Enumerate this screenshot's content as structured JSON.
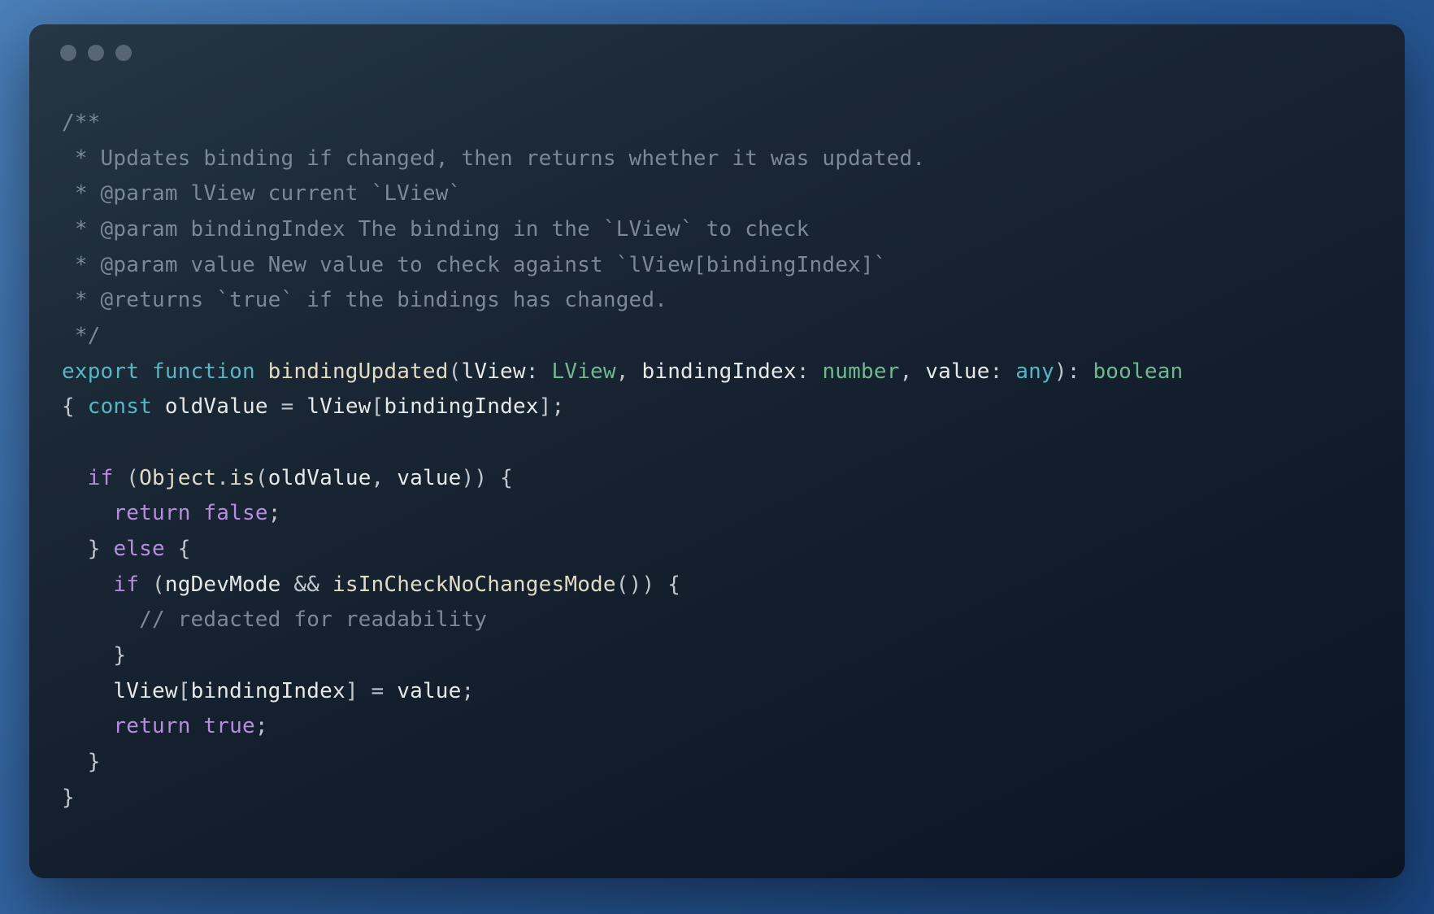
{
  "colors": {
    "bg_gradient_start": "#4a7fb8",
    "bg_gradient_end": "#1a4580",
    "window_bg": "#17202e",
    "dot": "#6a7683",
    "comment": "#7c8893",
    "keyword": "#56b6c2",
    "control": "#b78be0",
    "fn": "#e0dcc4",
    "type": "#6fb98f",
    "ident": "#e6e8ea",
    "literal": "#b78be0"
  },
  "cm": {
    "l1": "/**",
    "l2": " * Updates binding if changed, then returns whether it was updated.",
    "l3": " * @param lView current `LView`",
    "l4": " * @param bindingIndex The binding in the `LView` to check",
    "l5": " * @param value New value to check against `lView[bindingIndex]`",
    "l6": " * @returns `true` if the bindings has changed.",
    "l7": " */",
    "redacted": "// redacted for readability"
  },
  "kw": {
    "export": "export",
    "function": "function",
    "const": "const",
    "any": "any",
    "return": "return",
    "if": "if",
    "else": "else"
  },
  "fn": {
    "bindingUpdated": "bindingUpdated",
    "Object": "Object",
    "is": "is",
    "isInCheckNoChangesMode": "isInCheckNoChangesMode"
  },
  "ty": {
    "LView": "LView",
    "number": "number",
    "boolean": "boolean"
  },
  "id": {
    "lView": "lView",
    "bindingIndex": "bindingIndex",
    "value": "value",
    "oldValue": "oldValue",
    "ngDevMode": "ngDevMode"
  },
  "lit": {
    "false": "false",
    "true": "true"
  },
  "p": {
    "lparen": "(",
    "rparen": ")",
    "lbrack": "[",
    "rbrack": "]",
    "lbrace": "{",
    "rbrace": "}",
    "colon": ":",
    "comma": ",",
    "semi": ";",
    "eq": "=",
    "dot": ".",
    "ampamp": "&&"
  }
}
